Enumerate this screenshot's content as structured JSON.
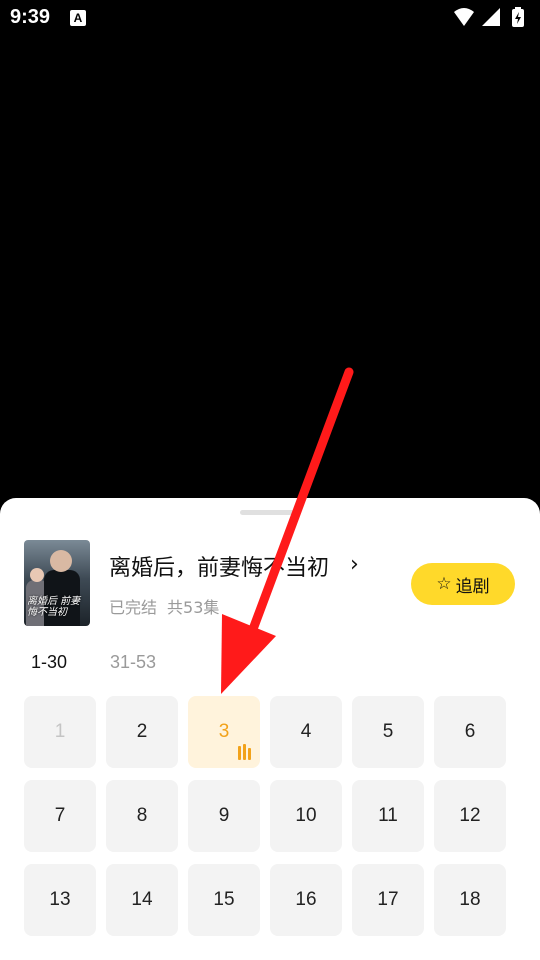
{
  "status_bar": {
    "time": "9:39",
    "notification_icon_letter": "A",
    "icons": [
      "wifi-icon",
      "signal-icon",
      "battery-charging-icon"
    ]
  },
  "drama": {
    "title": "离婚后，前妻悔不当初",
    "status": "已完结",
    "episode_count": "共53集",
    "follow_label": "追剧",
    "poster_text": "离婚后 前妻悔不当初"
  },
  "ranges": [
    "1-30",
    "31-53"
  ],
  "episodes": [
    "1",
    "2",
    "3",
    "4",
    "5",
    "6",
    "7",
    "8",
    "9",
    "10",
    "11",
    "12",
    "13",
    "14",
    "15",
    "16",
    "17",
    "18"
  ],
  "current_episode": "3",
  "colors": {
    "accent": "#ffd92a",
    "current_bg": "#fff3dc",
    "current_text": "#f2a21a",
    "arrow": "#ff1a1a"
  }
}
